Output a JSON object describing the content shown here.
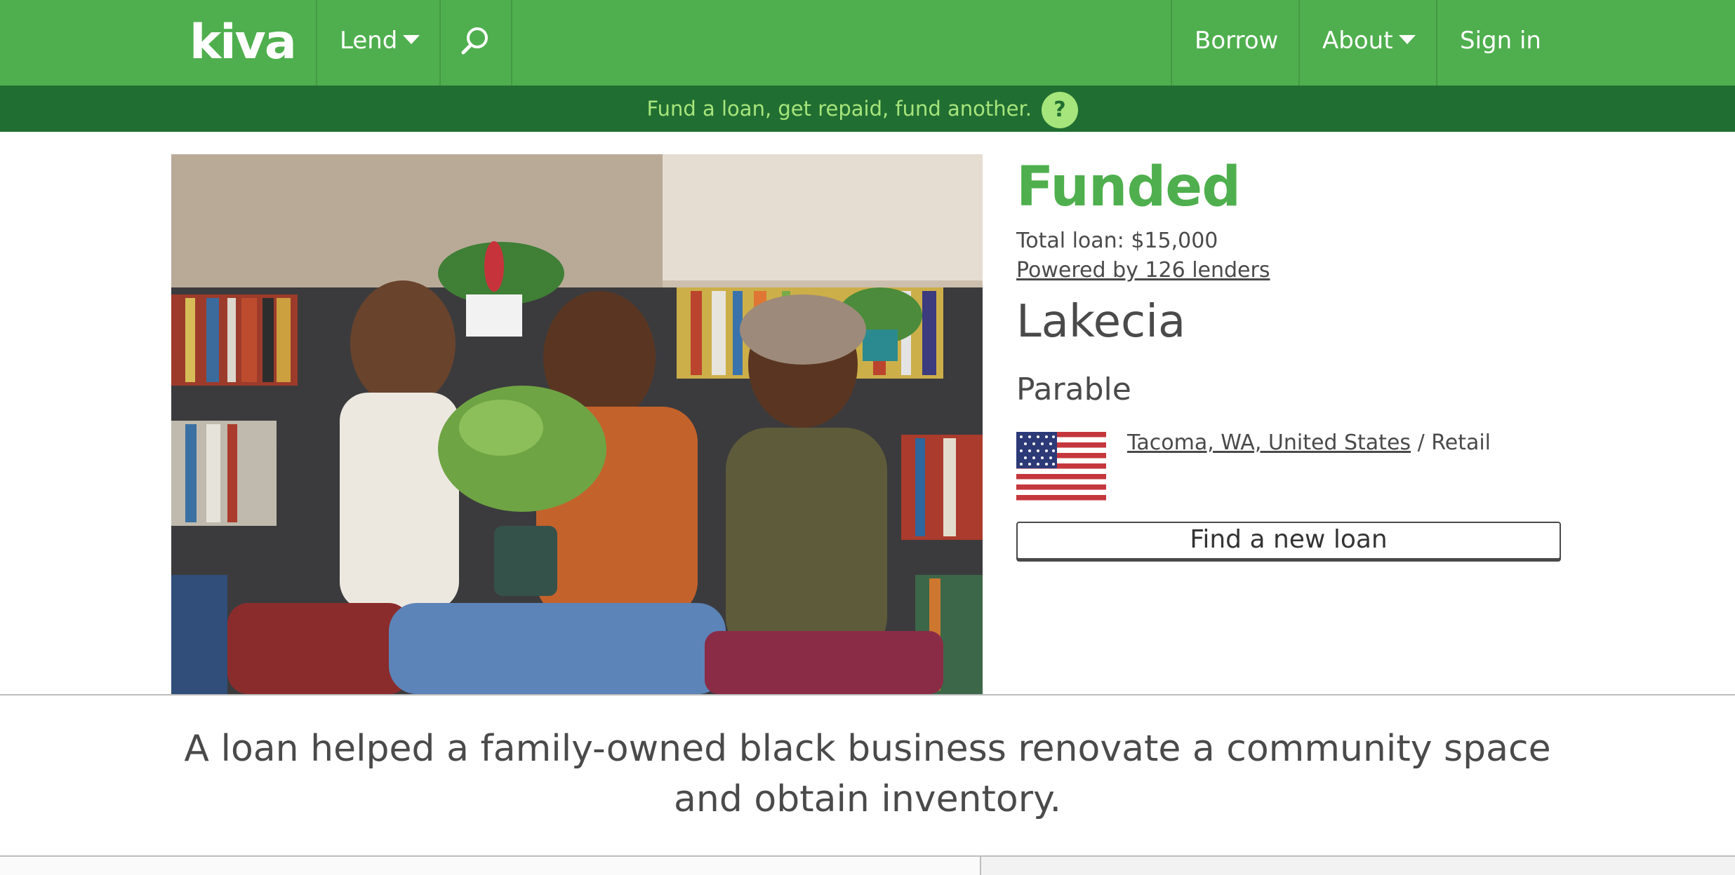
{
  "header": {
    "logo_text": "kiva",
    "nav_left": [
      {
        "label": "Lend",
        "has_dropdown": true
      }
    ],
    "search_icon": "search-icon",
    "nav_right": [
      {
        "label": "Borrow",
        "has_dropdown": false
      },
      {
        "label": "About",
        "has_dropdown": true
      },
      {
        "label": "Sign in",
        "has_dropdown": false
      }
    ],
    "colors": {
      "nav_bg": "#4faf4e",
      "tagbar_bg": "#216e32",
      "tagline_text": "#a6e57b"
    }
  },
  "tagline": {
    "text": "Fund a loan, get repaid, fund another.",
    "help_label": "?"
  },
  "loan": {
    "status": "Funded",
    "total_loan": "Total loan: $15,000",
    "lenders_link": "Powered by 126 lenders",
    "borrower_name": "Lakecia",
    "business_name": "Parable",
    "flag_icon": "us-flag-icon",
    "location_link": "Tacoma, WA, United States",
    "location_sep": " / ",
    "sector": "Retail",
    "find_button": "Find a new loan",
    "status_color": "#4faf4e"
  },
  "summary": {
    "text": "A loan helped a family-owned black business renovate a community space and obtain inventory."
  }
}
